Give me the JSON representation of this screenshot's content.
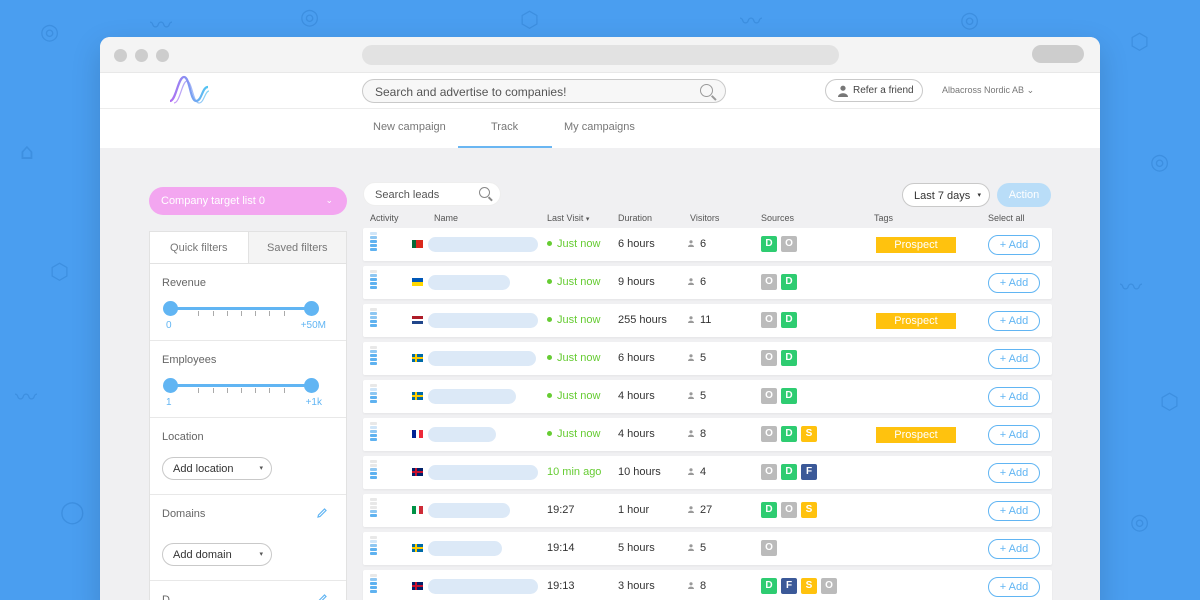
{
  "header": {
    "search_placeholder": "Search and advertise to companies!",
    "refer_label": "Refer a friend",
    "account_label": "Albacross Nordic AB",
    "account_caret": "⌄"
  },
  "tabs": [
    {
      "label": "New campaign"
    },
    {
      "label": "Track"
    },
    {
      "label": "My campaigns"
    }
  ],
  "sidebar": {
    "target_list": "Company target list 0",
    "target_caret": "⌄",
    "filter_tabs": [
      "Quick filters",
      "Saved filters"
    ],
    "revenue": {
      "title": "Revenue",
      "min": "0",
      "max": "+50M"
    },
    "employees": {
      "title": "Employees",
      "min": "1",
      "max": "+1k"
    },
    "location": {
      "title": "Location",
      "button": "Add location"
    },
    "domains": {
      "title": "Domains",
      "button": "Add domain"
    },
    "next_section_title": "D"
  },
  "toolbar": {
    "search_placeholder": "Search leads",
    "range_label": "Last 7 days",
    "action_label": "Action",
    "caret": "▾"
  },
  "columns": {
    "activity": "Activity",
    "name": "Name",
    "last_visit": "Last Visit",
    "last_visit_sort": "▾",
    "duration": "Duration",
    "visitors": "Visitors",
    "sources": "Sources",
    "tags": "Tags",
    "select_all": "Select all"
  },
  "source_colors": {
    "D": "#2ecc71",
    "O": "#bbbbbb",
    "S": "#ffc20e",
    "F": "#3b5998"
  },
  "add_label": "+ Add",
  "rows": [
    {
      "flag": "portugal",
      "last_visit": "Just now",
      "live": true,
      "duration": "6 hours",
      "visitors": "6",
      "sources": [
        "D",
        "O"
      ],
      "tag": "Prospect"
    },
    {
      "flag": "ukraine",
      "last_visit": "Just now",
      "live": true,
      "duration": "9 hours",
      "visitors": "6",
      "sources": [
        "O",
        "D"
      ],
      "tag": ""
    },
    {
      "flag": "netherlands",
      "last_visit": "Just now",
      "live": true,
      "duration": "255 hours",
      "visitors": "11",
      "sources": [
        "O",
        "D"
      ],
      "tag": "Prospect"
    },
    {
      "flag": "sweden",
      "last_visit": "Just now",
      "live": true,
      "duration": "6 hours",
      "visitors": "5",
      "sources": [
        "O",
        "D"
      ],
      "tag": ""
    },
    {
      "flag": "sweden",
      "last_visit": "Just now",
      "live": true,
      "duration": "4 hours",
      "visitors": "5",
      "sources": [
        "O",
        "D"
      ],
      "tag": ""
    },
    {
      "flag": "france",
      "last_visit": "Just now",
      "live": true,
      "duration": "4 hours",
      "visitors": "8",
      "sources": [
        "O",
        "D",
        "S"
      ],
      "tag": "Prospect"
    },
    {
      "flag": "uk",
      "last_visit": "10 min ago",
      "live": false,
      "recent": true,
      "duration": "10 hours",
      "visitors": "4",
      "sources": [
        "O",
        "D",
        "F"
      ],
      "tag": ""
    },
    {
      "flag": "italy",
      "last_visit": "19:27",
      "live": false,
      "duration": "1 hour",
      "visitors": "27",
      "sources": [
        "D",
        "O",
        "S"
      ],
      "tag": ""
    },
    {
      "flag": "sweden",
      "last_visit": "19:14",
      "live": false,
      "duration": "5 hours",
      "visitors": "5",
      "sources": [
        "O"
      ],
      "tag": ""
    },
    {
      "flag": "uk",
      "last_visit": "19:13",
      "live": false,
      "duration": "3 hours",
      "visitors": "8",
      "sources": [
        "D",
        "F",
        "S",
        "O"
      ],
      "tag": ""
    }
  ]
}
